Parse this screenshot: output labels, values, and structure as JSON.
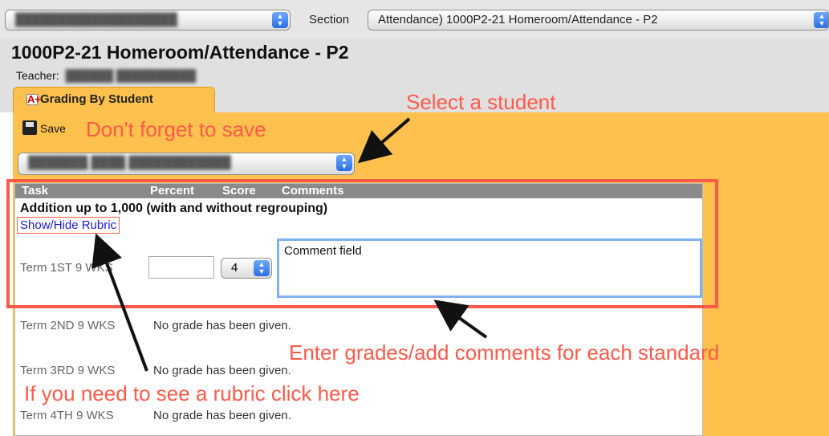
{
  "top": {
    "course_select_value": "",
    "section_label": "Section",
    "section_select_value": "Attendance) 1000P2-21 Homeroom/Attendance - P2"
  },
  "page_title": "1000P2-21 Homeroom/Attendance - P2",
  "teacher_label": "Teacher:",
  "tab_label": "Grading By Student",
  "tab_icon_text": "A+",
  "save_label": "Save",
  "student_select_value": "",
  "table": {
    "headers": [
      "Task",
      "Percent",
      "Score",
      "Comments"
    ],
    "task_name": "Addition up to 1,000 (with and without regrouping)",
    "rubric_link": "Show/Hide Rubric",
    "terms": [
      {
        "label": "Term 1ST 9 WKS",
        "score": "4",
        "comment": "Comment field"
      },
      {
        "label": "Term 2ND 9 WKS",
        "status": "No grade has been given."
      },
      {
        "label": "Term 3RD 9 WKS",
        "status": "No grade has been given."
      },
      {
        "label": "Term 4TH 9 WKS",
        "status": "No grade has been given."
      }
    ]
  },
  "annotations": {
    "select_student": "Select a student",
    "dont_forget": "Don't forget to save",
    "enter_grades": "Enter grades/add comments for each standard",
    "rubric_hint": "If you need to see a rubric click here"
  },
  "colors": {
    "panel": "#ffc14d",
    "annotation": "#ff5a4a",
    "link": "#1a1acc"
  }
}
